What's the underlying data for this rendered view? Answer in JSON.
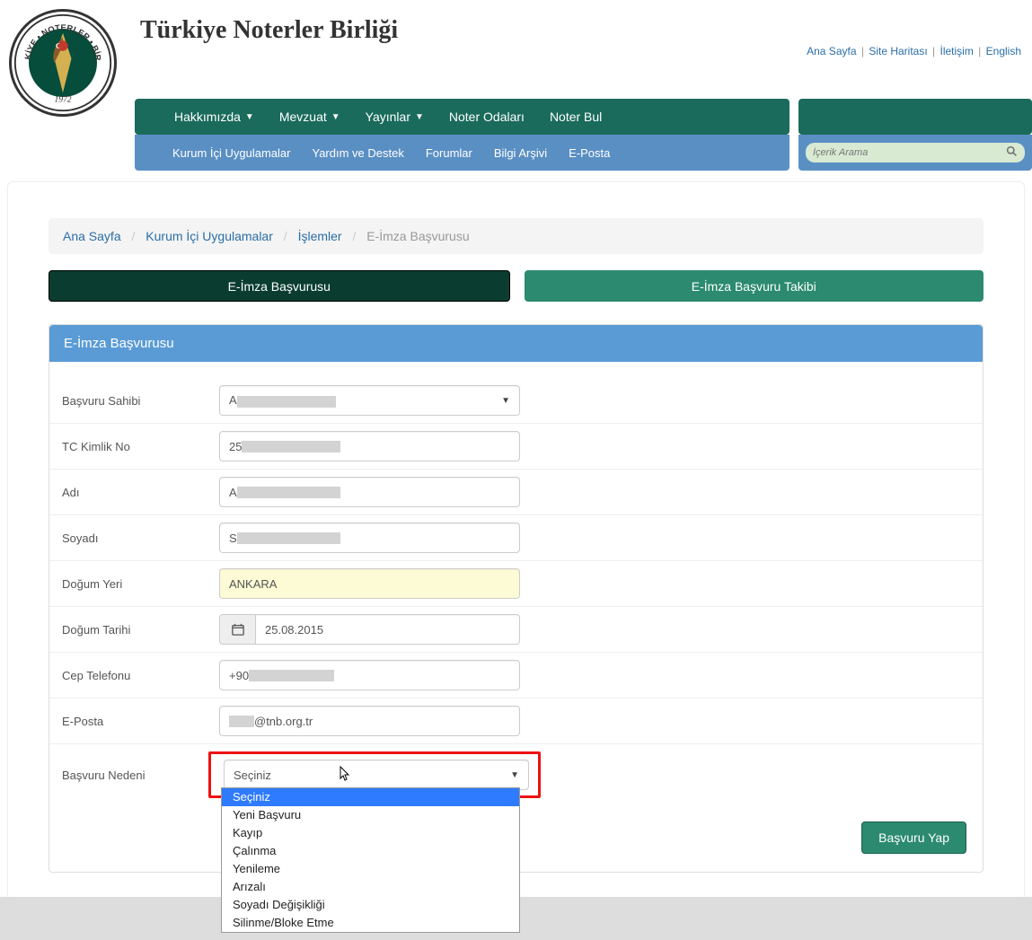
{
  "site_title": "Türkiye Noterler Birliği",
  "top_links": {
    "home": "Ana Sayfa",
    "sitemap": "Site Haritası",
    "contact": "İletişim",
    "english": "English"
  },
  "nav_main": [
    {
      "label": "Hakkımızda",
      "dropdown": true
    },
    {
      "label": "Mevzuat",
      "dropdown": true
    },
    {
      "label": "Yayınlar",
      "dropdown": true
    },
    {
      "label": "Noter Odaları",
      "dropdown": false
    },
    {
      "label": "Noter Bul",
      "dropdown": false
    }
  ],
  "nav_sub": [
    "Kurum İçi Uygulamalar",
    "Yardım ve Destek",
    "Forumlar",
    "Bilgi Arşivi",
    "E-Posta"
  ],
  "search_placeholder": "İçerik Arama",
  "breadcrumb": {
    "home": "Ana Sayfa",
    "apps": "Kurum İçi Uygulamalar",
    "ops": "İşlemler",
    "current": "E-İmza Başvurusu"
  },
  "tabs": {
    "apply": "E-İmza Başvurusu",
    "track": "E-İmza Başvuru Takibi"
  },
  "panel_title": "E-İmza Başvurusu",
  "form": {
    "owner_label": "Başvuru Sahibi",
    "owner_value": "A",
    "tc_label": "TC Kimlik No",
    "tc_value": "25",
    "name_label": "Adı",
    "name_value": "A",
    "surname_label": "Soyadı",
    "surname_value": "S",
    "birthplace_label": "Doğum Yeri",
    "birthplace_value": "ANKARA",
    "birthdate_label": "Doğum Tarihi",
    "birthdate_value": "25.08.2015",
    "phone_label": "Cep Telefonu",
    "phone_value": "+90",
    "email_label": "E-Posta",
    "email_value_suffix": "@tnb.org.tr",
    "reason_label": "Başvuru Nedeni",
    "reason_selected": "Seçiniz",
    "reason_options": [
      "Seçiniz",
      "Yeni Başvuru",
      "Kayıp",
      "Çalınma",
      "Yenileme",
      "Arızalı",
      "Soyadı Değişikliği",
      "Silinme/Bloke Etme"
    ]
  },
  "submit_label": "Başvuru Yap"
}
